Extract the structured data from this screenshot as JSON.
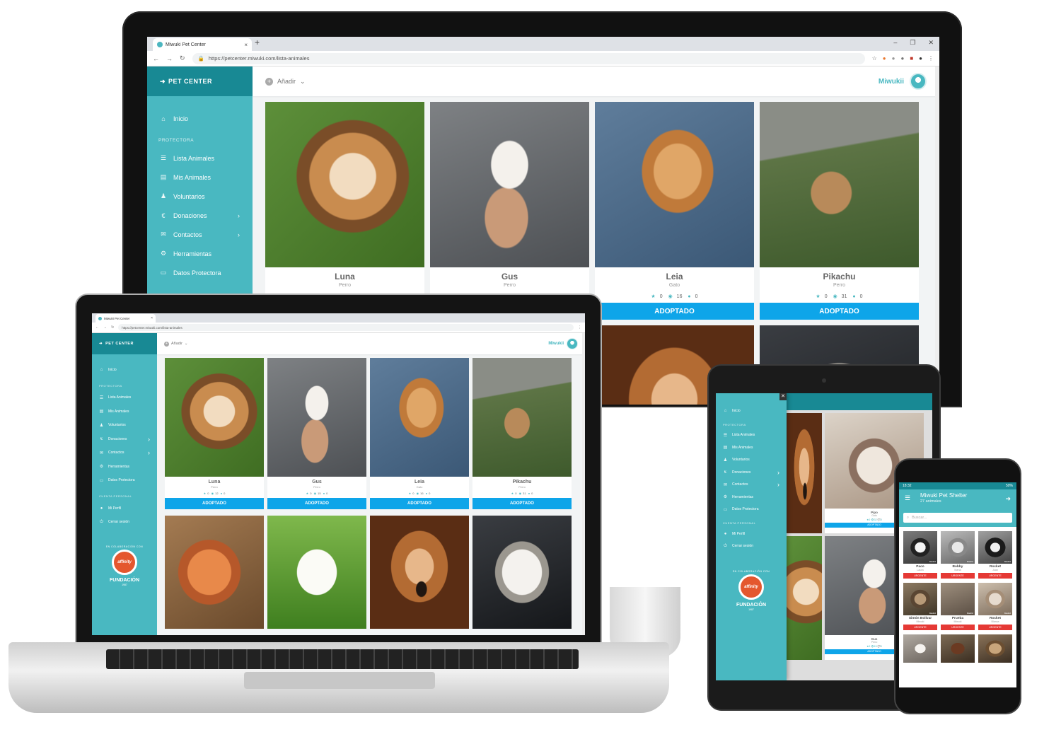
{
  "browser": {
    "tab_title": "Miwuki Pet Center",
    "tab_close": "×",
    "new_tab": "+",
    "win_min": "–",
    "win_max": "❐",
    "win_close": "✕",
    "url": "https://petcenter.miwuki.com/lista-animales",
    "back": "←",
    "forward": "→",
    "reload": "↻",
    "lock": "🔒",
    "star": "☆",
    "menu": "⋮"
  },
  "app": {
    "brand": "PET CENTER",
    "add_label": "Añadir",
    "add_caret": "⌄",
    "username": "Miwukii"
  },
  "sidebar": {
    "items_top": [
      {
        "label": "Inicio"
      }
    ],
    "section_protectora": "PROTECTORA",
    "items_protectora": [
      {
        "label": "Lista Animales"
      },
      {
        "label": "Mis Animales"
      },
      {
        "label": "Voluntarios"
      },
      {
        "label": "Donaciones",
        "chevron": "›"
      },
      {
        "label": "Contactos",
        "chevron": "›"
      },
      {
        "label": "Herramientas"
      },
      {
        "label": "Datos Protectora"
      }
    ],
    "section_cuenta": "CUENTA PERSONAL",
    "items_cuenta": [
      {
        "label": "Mi Perfil"
      },
      {
        "label": "Cerrar sesión"
      }
    ],
    "partner": {
      "arc_text": "EN COLABORACIÓN CON",
      "logo_text": "affinity",
      "fund_text": "FUNDACIÓN",
      "year": "1987"
    }
  },
  "animals": [
    {
      "name": "Luna",
      "species": "Perro",
      "stars": "0",
      "views": "12",
      "comments": "0",
      "status": "ADOPTADO"
    },
    {
      "name": "Gus",
      "species": "Perro",
      "stars": "0",
      "views": "15",
      "comments": "0",
      "status": "ADOPTADO"
    },
    {
      "name": "Leia",
      "species": "Gato",
      "stars": "0",
      "views": "16",
      "comments": "0",
      "status": "ADOPTADO"
    },
    {
      "name": "Pikachu",
      "species": "Perro",
      "stars": "0",
      "views": "31",
      "comments": "0",
      "status": "ADOPTADO"
    }
  ],
  "tablet": {
    "close": "✕",
    "card_pipo": {
      "name": "Pipo",
      "species": "Gato",
      "stats": "★0 👁32 💬0",
      "status": "ADOPTADO"
    },
    "card_gus": {
      "name": "Gus",
      "species": "Perro",
      "stats": "★0 👁15 💬0",
      "status": "ADOPTADO"
    }
  },
  "phone": {
    "time": "18:32",
    "battery": "50%",
    "title": "Miwuki Pet Shelter",
    "subtitle": "27 animales",
    "search_placeholder": "Buscar...",
    "pets": [
      {
        "name": "Paco",
        "owner": "Laura",
        "location": "Madrid",
        "status": "URGENTE"
      },
      {
        "name": "Bobby",
        "owner": "Marta",
        "location": "Madrid",
        "status": "URGENTE"
      },
      {
        "name": "Rocket",
        "owner": "Juan",
        "location": "Madrid",
        "status": "URGENTE"
      },
      {
        "name": "Simón Bolívar",
        "owner": "Miwuki",
        "location": "Madrid",
        "status": "URGENTE"
      },
      {
        "name": "Prueba",
        "owner": "Miwuki",
        "location": "Madrid",
        "status": "URGENTE"
      },
      {
        "name": "Rocket",
        "owner": "Blanca",
        "location": "Madrid",
        "status": "URGENTE"
      }
    ]
  },
  "icons": {
    "home": "⌂",
    "list": "☰",
    "id": "▤",
    "group": "♟",
    "euro": "€",
    "mail": "✉",
    "gear": "⚙",
    "card": "▭",
    "user": "●",
    "logout": "⏻",
    "star": "★",
    "eye": "◉",
    "chat": "●",
    "paw": "➜",
    "search": "⌕"
  }
}
